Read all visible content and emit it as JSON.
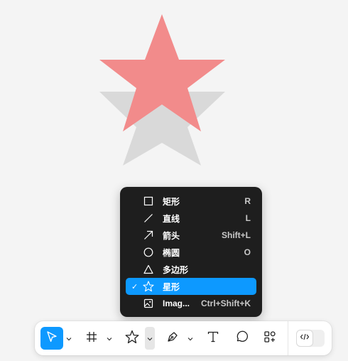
{
  "canvas": {
    "star_fill": "#f28b8b",
    "shadow_star_fill": "#d9d9d9",
    "background": "#f4f4f4"
  },
  "shape_menu": {
    "items": [
      {
        "icon": "rectangle-icon",
        "label": "矩形",
        "shortcut": "R",
        "selected": false
      },
      {
        "icon": "line-icon",
        "label": "直线",
        "shortcut": "L",
        "selected": false
      },
      {
        "icon": "arrow-icon",
        "label": "箭头",
        "shortcut": "Shift+L",
        "selected": false
      },
      {
        "icon": "ellipse-icon",
        "label": "椭圆",
        "shortcut": "O",
        "selected": false
      },
      {
        "icon": "polygon-icon",
        "label": "多边形",
        "shortcut": "",
        "selected": false
      },
      {
        "icon": "star-icon",
        "label": "星形",
        "shortcut": "",
        "selected": true
      },
      {
        "icon": "image-icon",
        "label": "Imag...",
        "shortcut": "Ctrl+Shift+K",
        "selected": false
      }
    ],
    "check_mark": "✓"
  },
  "toolbar": {
    "accent": "#0d99ff",
    "tools": [
      {
        "icon": "move-cursor-icon",
        "active": true
      },
      {
        "icon": "frame-icon",
        "active": false
      },
      {
        "icon": "star-icon",
        "active": false
      },
      {
        "icon": "pen-icon",
        "active": false
      },
      {
        "icon": "text-icon",
        "active": false
      },
      {
        "icon": "comment-icon",
        "active": false
      },
      {
        "icon": "actions-icon",
        "active": false
      },
      {
        "icon": "dev-mode-icon",
        "active": false
      }
    ]
  }
}
